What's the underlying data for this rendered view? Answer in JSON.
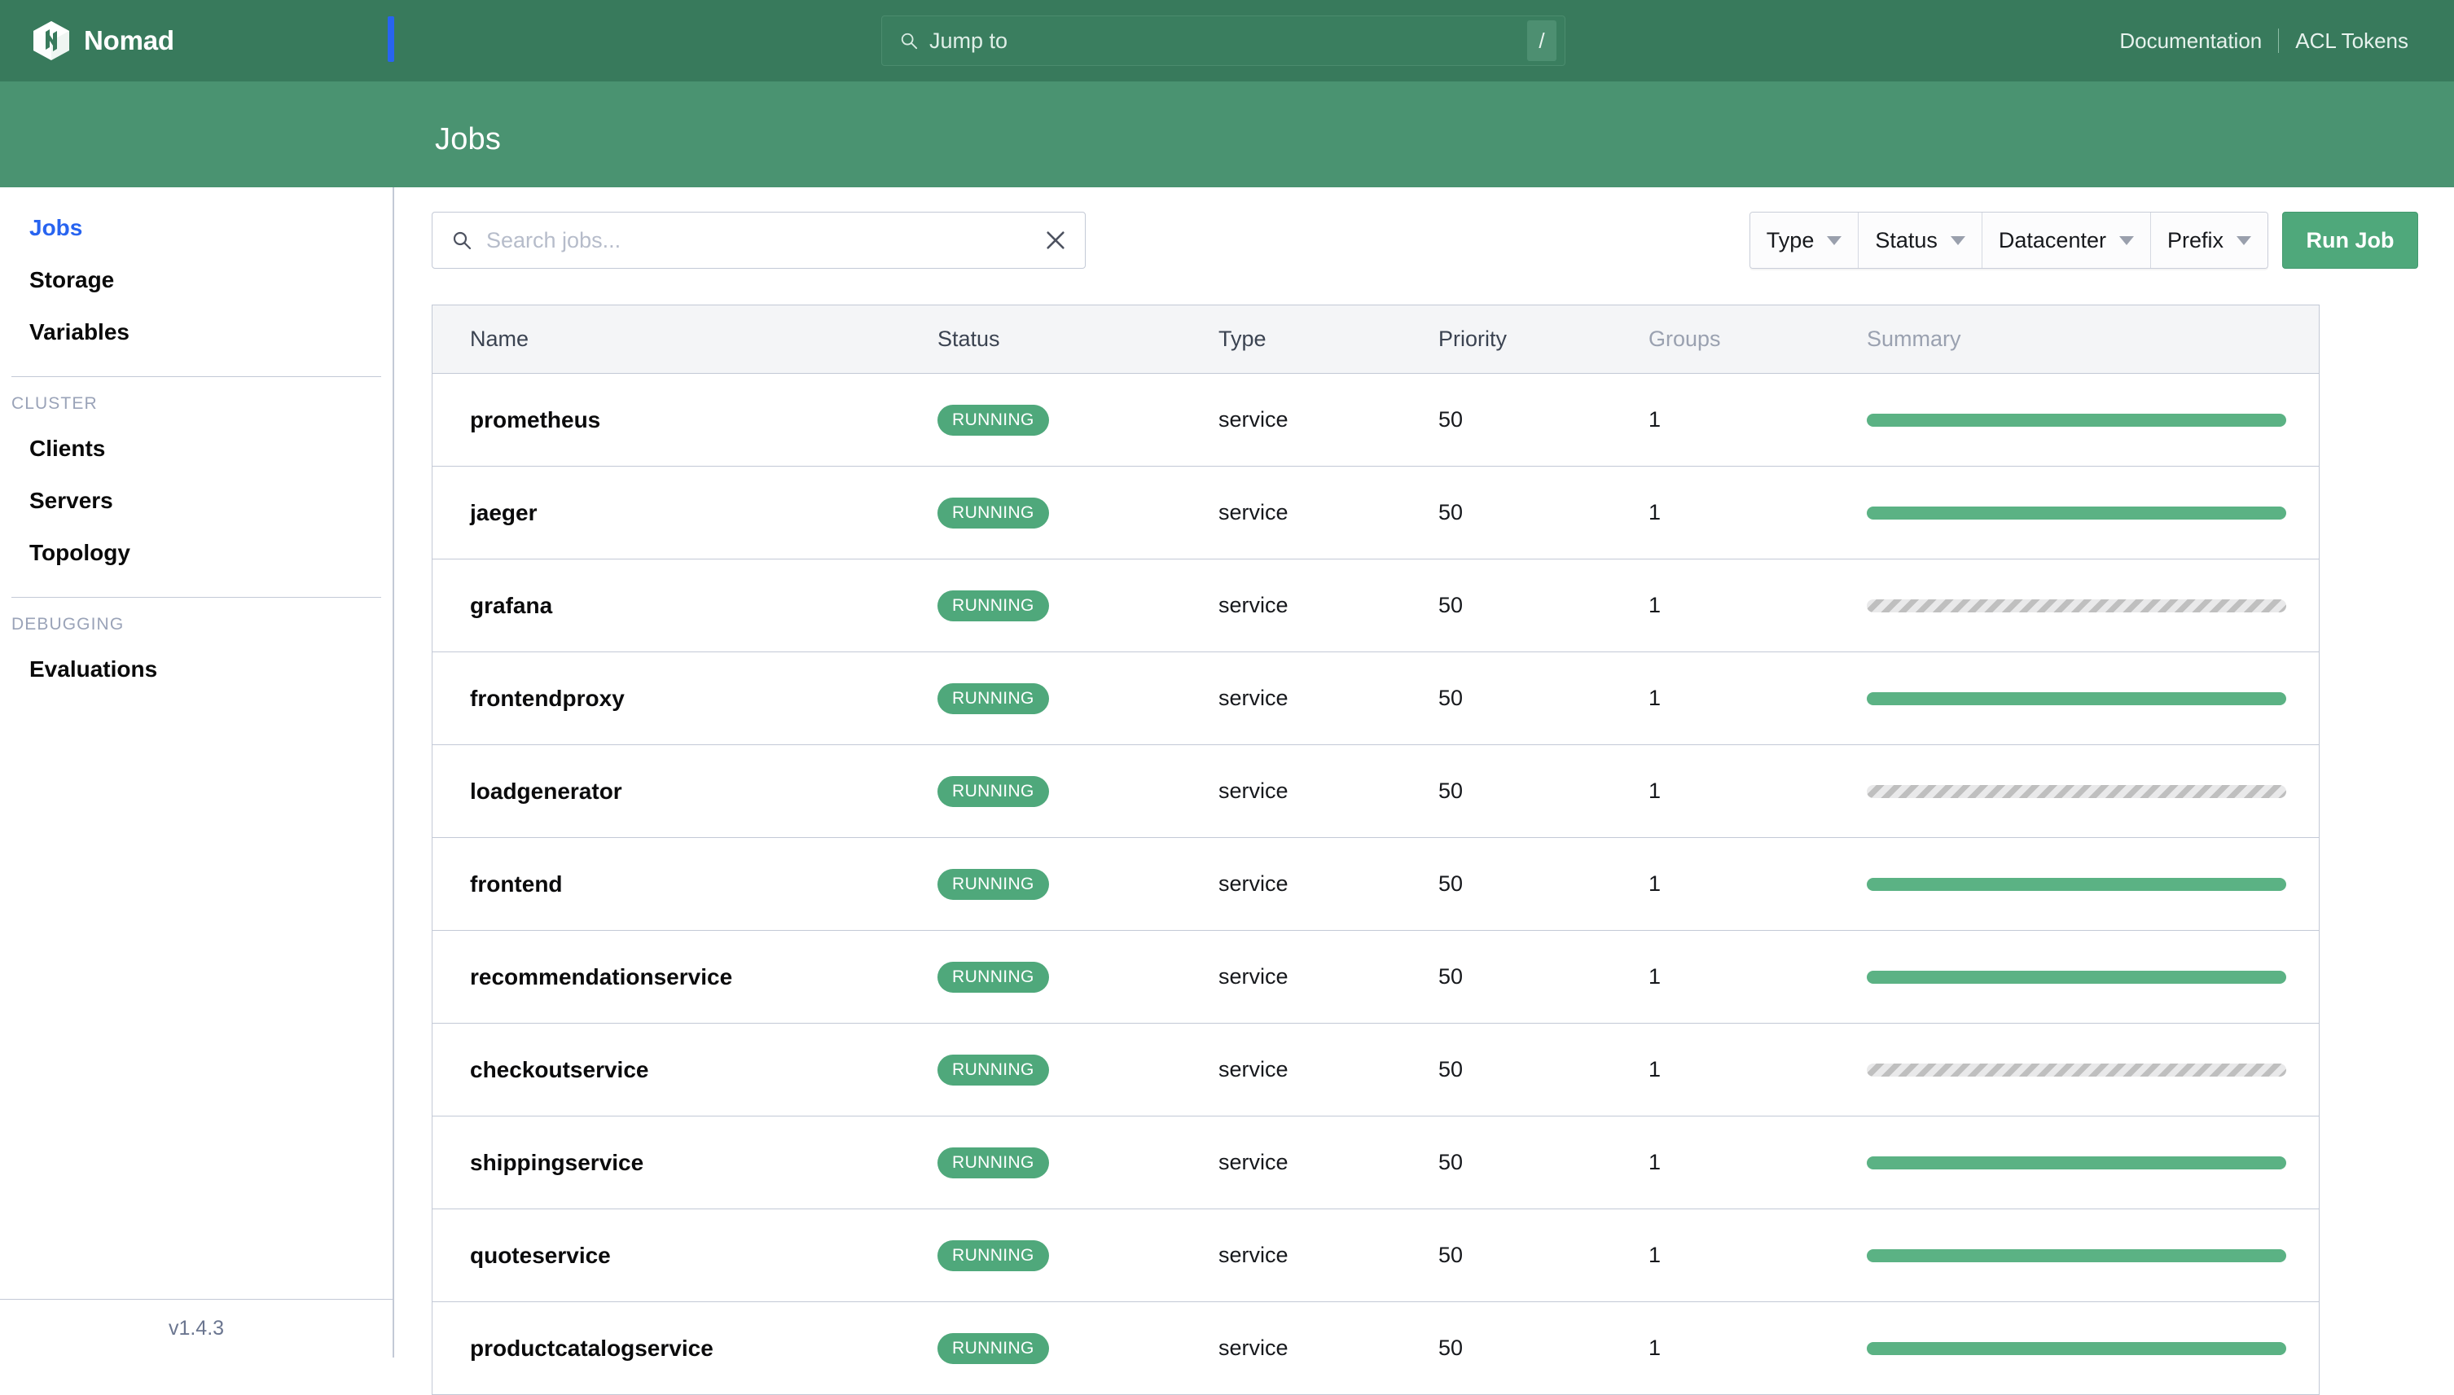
{
  "header": {
    "brand": "Nomad",
    "jump_to_placeholder": "Jump to",
    "jump_to_shortcut": "/",
    "links": [
      {
        "label": "Documentation"
      },
      {
        "label": "ACL Tokens"
      }
    ]
  },
  "page": {
    "title": "Jobs"
  },
  "sidebar": {
    "primary": [
      {
        "label": "Jobs",
        "active": true
      },
      {
        "label": "Storage",
        "active": false
      },
      {
        "label": "Variables",
        "active": false
      }
    ],
    "cluster_heading": "CLUSTER",
    "cluster": [
      {
        "label": "Clients"
      },
      {
        "label": "Servers"
      },
      {
        "label": "Topology"
      }
    ],
    "debugging_heading": "DEBUGGING",
    "debugging": [
      {
        "label": "Evaluations"
      }
    ],
    "version": "v1.4.3"
  },
  "toolbar": {
    "search_placeholder": "Search jobs...",
    "filters": [
      {
        "label": "Type"
      },
      {
        "label": "Status"
      },
      {
        "label": "Datacenter"
      },
      {
        "label": "Prefix"
      }
    ],
    "run_job_label": "Run Job"
  },
  "table": {
    "columns": [
      {
        "label": "Name",
        "dim": false
      },
      {
        "label": "Status",
        "dim": false
      },
      {
        "label": "Type",
        "dim": false
      },
      {
        "label": "Priority",
        "dim": false
      },
      {
        "label": "Groups",
        "dim": true
      },
      {
        "label": "Summary",
        "dim": true
      }
    ],
    "rows": [
      {
        "name": "prometheus",
        "status": "RUNNING",
        "type": "service",
        "priority": "50",
        "groups": "1",
        "summary": "running"
      },
      {
        "name": "jaeger",
        "status": "RUNNING",
        "type": "service",
        "priority": "50",
        "groups": "1",
        "summary": "running"
      },
      {
        "name": "grafana",
        "status": "RUNNING",
        "type": "service",
        "priority": "50",
        "groups": "1",
        "summary": "pending"
      },
      {
        "name": "frontendproxy",
        "status": "RUNNING",
        "type": "service",
        "priority": "50",
        "groups": "1",
        "summary": "running"
      },
      {
        "name": "loadgenerator",
        "status": "RUNNING",
        "type": "service",
        "priority": "50",
        "groups": "1",
        "summary": "pending"
      },
      {
        "name": "frontend",
        "status": "RUNNING",
        "type": "service",
        "priority": "50",
        "groups": "1",
        "summary": "running"
      },
      {
        "name": "recommendationservice",
        "status": "RUNNING",
        "type": "service",
        "priority": "50",
        "groups": "1",
        "summary": "running"
      },
      {
        "name": "checkoutservice",
        "status": "RUNNING",
        "type": "service",
        "priority": "50",
        "groups": "1",
        "summary": "pending"
      },
      {
        "name": "shippingservice",
        "status": "RUNNING",
        "type": "service",
        "priority": "50",
        "groups": "1",
        "summary": "running"
      },
      {
        "name": "quoteservice",
        "status": "RUNNING",
        "type": "service",
        "priority": "50",
        "groups": "1",
        "summary": "running"
      },
      {
        "name": "productcatalogservice",
        "status": "RUNNING",
        "type": "service",
        "priority": "50",
        "groups": "1",
        "summary": "running"
      }
    ]
  },
  "colors": {
    "header_green": "#387a5c",
    "band_green": "#4a9371",
    "accent_green": "#4fa87b",
    "summary_green": "#5bb284",
    "active_blue": "#2864f0",
    "border_gray": "#c3c9d6"
  }
}
